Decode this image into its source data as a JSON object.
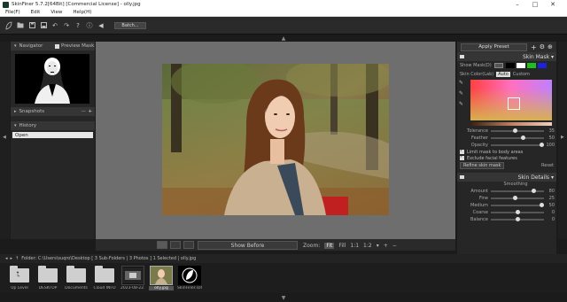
{
  "window": {
    "title": "SkinFiner 5.7.2[64Bit] [Commercial License] - olly.jpg"
  },
  "menu": [
    "File(F)",
    "Edit",
    "View",
    "Help(H)"
  ],
  "toolbar": {
    "batch_label": "Batch..."
  },
  "left": {
    "navigator": {
      "title": "Navigator",
      "preview_mask": "Preview Mask"
    },
    "snapshots": {
      "title": "Snapshots"
    },
    "history": {
      "title": "History",
      "items": [
        "Open"
      ]
    }
  },
  "right": {
    "preset_label": "Apply Preset",
    "skin_mask": {
      "title": "Skin Mask",
      "show_mask": "Show Mask(D)",
      "skin_color_label": "Skin Color(Lab)",
      "auto": "Auto",
      "custom": "Custom",
      "sliders": [
        {
          "label": "Tolerance",
          "value": "35",
          "pos": 0.45
        },
        {
          "label": "Feather",
          "value": "50",
          "pos": 0.6
        },
        {
          "label": "Opacity",
          "value": "100",
          "pos": 0.95
        }
      ],
      "checks": [
        "Limit mask to body areas",
        "Exclude facial features"
      ],
      "refine": "Refine skin mask",
      "reset": "Reset"
    },
    "skin_details": {
      "title": "Skin Details",
      "smoothing": "Smoothing",
      "sliders": [
        {
          "label": "Amount",
          "value": "80",
          "pos": 0.8
        },
        {
          "label": "Fine",
          "value": "25",
          "pos": 0.45
        },
        {
          "label": "Medium",
          "value": "50",
          "pos": 0.95
        },
        {
          "label": "Coarse",
          "value": "0",
          "pos": 0.5
        },
        {
          "label": "Balance",
          "value": "0",
          "pos": 0.5
        }
      ]
    }
  },
  "viewer": {
    "show_before": "Show Before",
    "zoom_label": "Zoom:",
    "zoom_options": [
      "Fit",
      "Fill",
      "1:1",
      "1:2"
    ]
  },
  "folder_path": "Folder: C:\\Users\\suqro\\Desktop [ 3 Sub-Folders | 3 Photos ] 1 Selected | olly.jpg",
  "filmstrip": [
    {
      "label": "Up Level",
      "kind": "up"
    },
    {
      "label": "DESKTOP",
      "kind": "folder"
    },
    {
      "label": "Documents",
      "kind": "folder"
    },
    {
      "label": "Cloud INFO",
      "kind": "folder"
    },
    {
      "label": "2023-08-22...",
      "kind": "photo-dark"
    },
    {
      "label": "olly.jpg",
      "kind": "photo-selected"
    },
    {
      "label": "SkinFiner.sof...",
      "kind": "logo"
    }
  ],
  "colors": {
    "accent": "#2b6cff",
    "bg": "#1b1b1b",
    "panel": "#262626"
  }
}
